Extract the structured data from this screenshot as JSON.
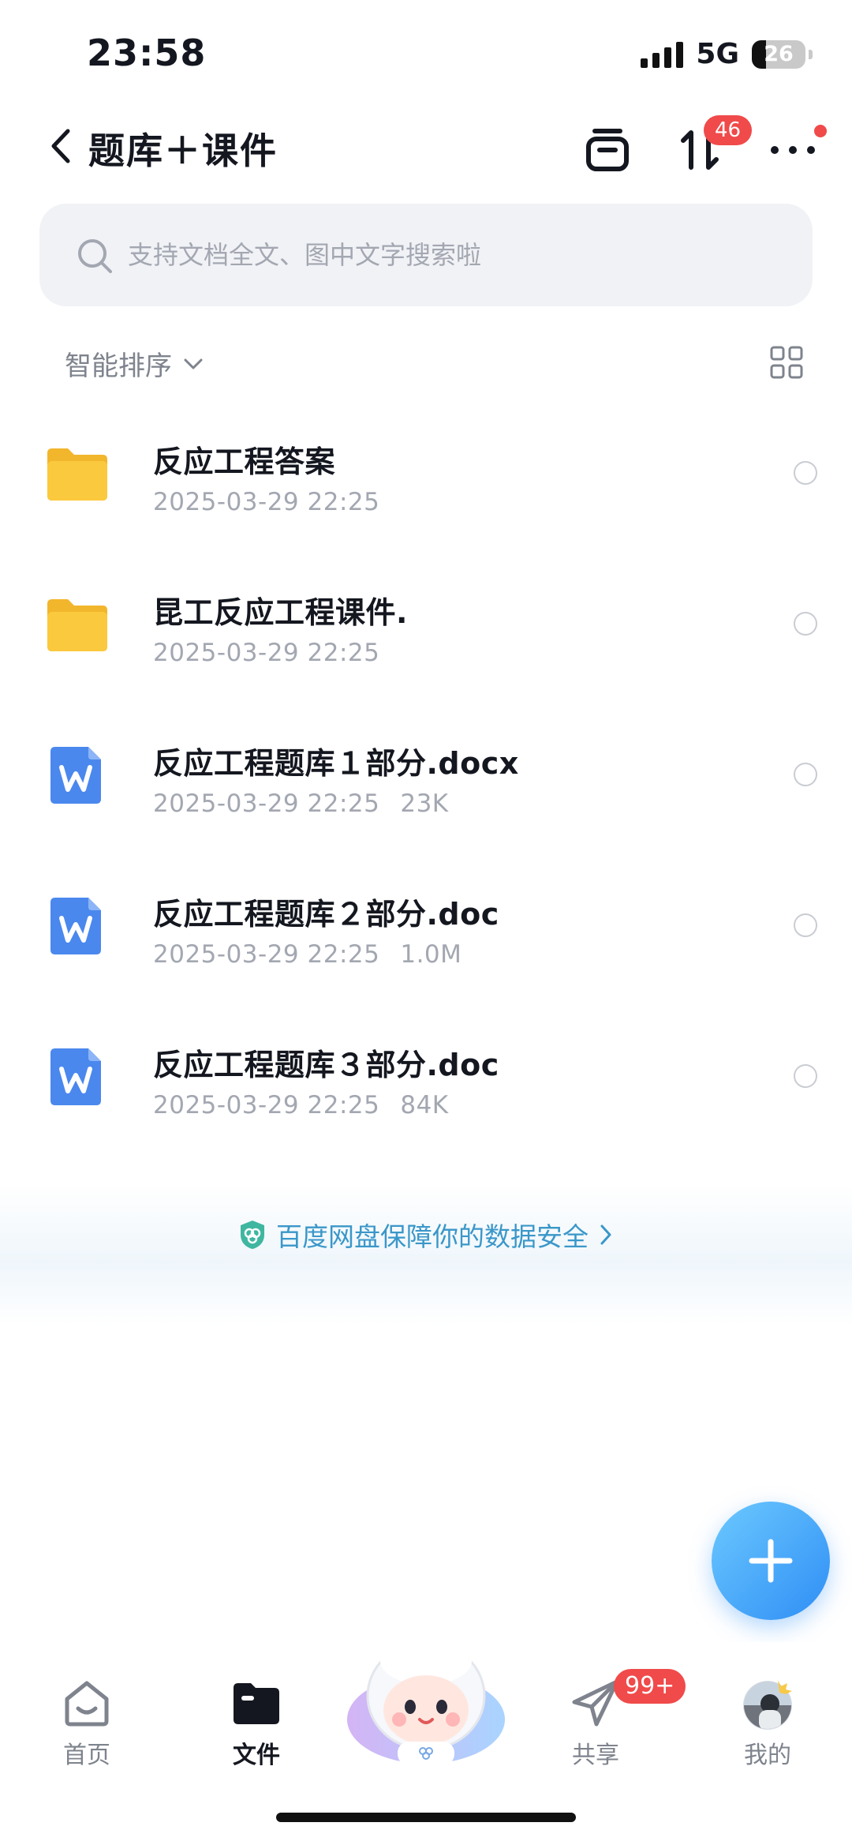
{
  "status": {
    "time": "23:58",
    "network": "5G",
    "battery": "26",
    "battery_level": 0.26
  },
  "header": {
    "title": "题库＋课件",
    "transfer_badge": "46"
  },
  "search": {
    "placeholder": "支持文档全文、图中文字搜索啦"
  },
  "sort": {
    "label": "智能排序"
  },
  "files": [
    {
      "name": "反应工程答案",
      "date": "2025-03-29 22:25",
      "size": "",
      "type": "folder"
    },
    {
      "name": "昆工反应工程课件.",
      "date": "2025-03-29 22:25",
      "size": "",
      "type": "folder"
    },
    {
      "name": "反应工程题库１部分.docx",
      "date": "2025-03-29 22:25",
      "size": "23K",
      "type": "word"
    },
    {
      "name": "反应工程题库２部分.doc",
      "date": "2025-03-29 22:25",
      "size": "1.0M",
      "type": "word"
    },
    {
      "name": "反应工程题库３部分.doc",
      "date": "2025-03-29 22:25",
      "size": "84K",
      "type": "word"
    }
  ],
  "security": {
    "text": "百度网盘保障你的数据安全"
  },
  "nav": {
    "items": [
      {
        "label": "首页",
        "icon": "home-icon"
      },
      {
        "label": "文件",
        "icon": "folder-icon",
        "active": true
      },
      {
        "label": "",
        "icon": "assistant-mascot-icon"
      },
      {
        "label": "共享",
        "icon": "share-plane-icon",
        "badge": "99+"
      },
      {
        "label": "我的",
        "icon": "avatar"
      }
    ]
  },
  "colors": {
    "accent": "#2f8ef5",
    "badge": "#f04a4a",
    "folder": "#fbc93d",
    "word": "#4a88ee",
    "security": "#3a97c9"
  }
}
